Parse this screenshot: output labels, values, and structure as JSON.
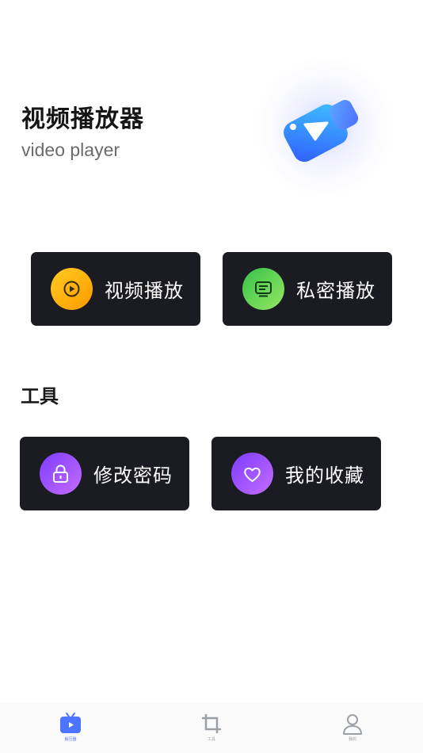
{
  "header": {
    "title": "视频播放器",
    "subtitle": "video player"
  },
  "hero": {
    "icon": "video-play-3d-icon",
    "colors": [
      "#3f7bff",
      "#37c3ff"
    ]
  },
  "main_actions": [
    {
      "label": "视频播放",
      "icon": "play-circle-icon",
      "gradient": [
        "#ffc21a",
        "#ff9d00"
      ]
    },
    {
      "label": "私密播放",
      "icon": "private-screen-icon",
      "gradient": [
        "#3fc84c",
        "#8be35d"
      ]
    }
  ],
  "tools": {
    "title": "工具",
    "items": [
      {
        "label": "修改密码",
        "icon": "lock-icon",
        "gradient": [
          "#8a46ff",
          "#c06dff"
        ]
      },
      {
        "label": "我的收藏",
        "icon": "heart-icon",
        "gradient": [
          "#8a46ff",
          "#c06dff"
        ]
      }
    ]
  },
  "tabbar": {
    "tabs": [
      {
        "label": "解压器",
        "icon": "tv-icon",
        "active": true
      },
      {
        "label": "工具",
        "icon": "crop-icon",
        "active": false
      },
      {
        "label": "我的",
        "icon": "user-icon",
        "active": false
      }
    ],
    "active_color": "#5b7cff",
    "inactive_color": "#9aa0a6"
  }
}
